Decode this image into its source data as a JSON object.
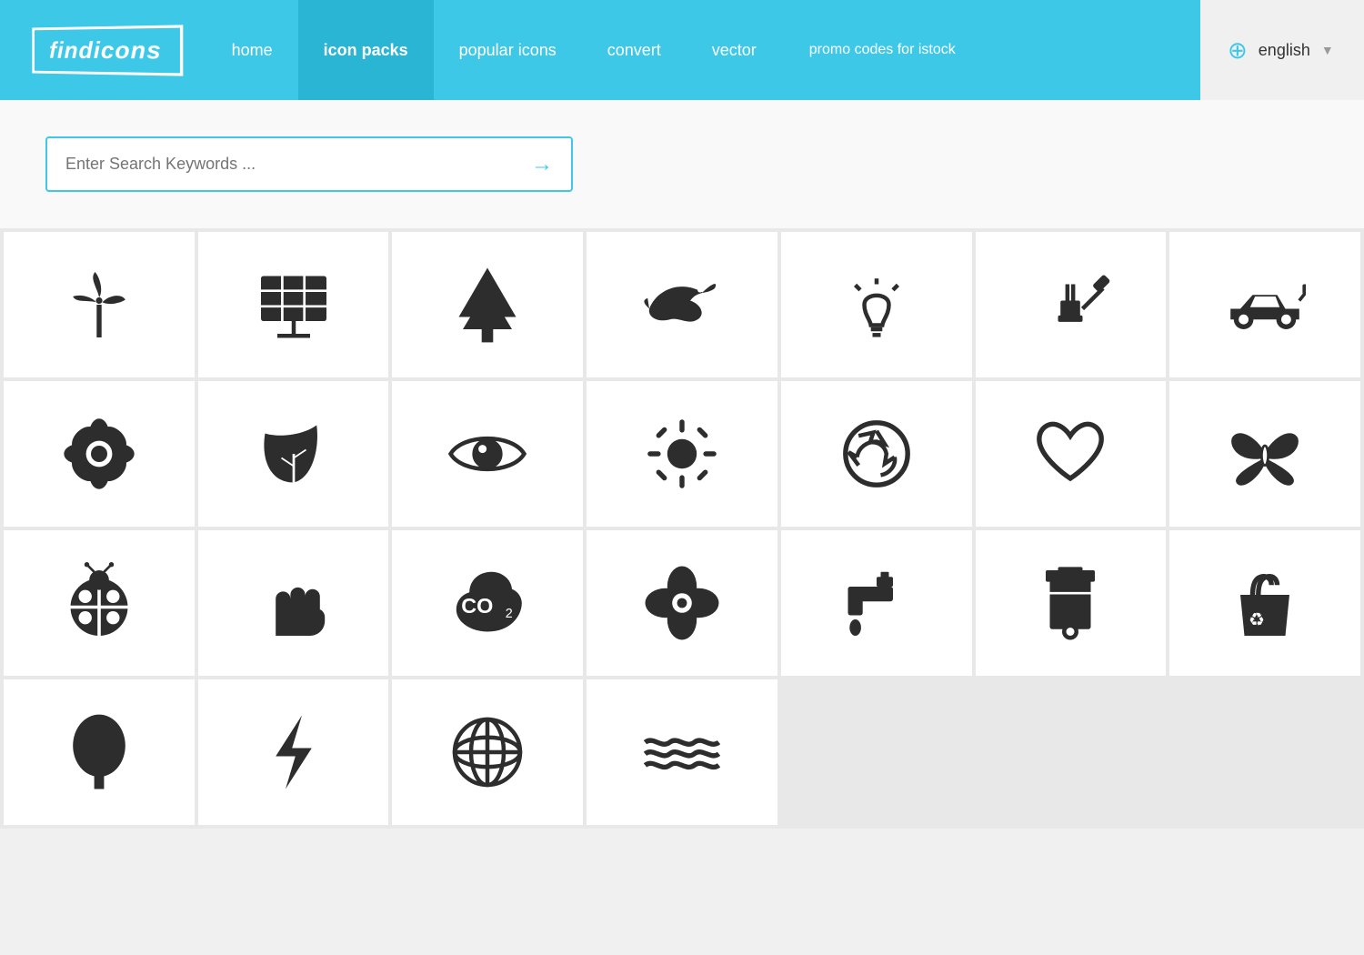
{
  "nav": {
    "logo": "findicons",
    "links": [
      {
        "label": "home",
        "active": false
      },
      {
        "label": "icon packs",
        "active": true
      },
      {
        "label": "popular icons",
        "active": false
      },
      {
        "label": "convert",
        "active": false
      },
      {
        "label": "vector",
        "active": false
      }
    ],
    "promo": "promo codes for istock",
    "lang": "english"
  },
  "search": {
    "placeholder": "Enter Search Keywords ..."
  },
  "icons": [
    {
      "name": "wind-turbine"
    },
    {
      "name": "solar-panel"
    },
    {
      "name": "pine-tree"
    },
    {
      "name": "bird"
    },
    {
      "name": "lightbulb"
    },
    {
      "name": "plug"
    },
    {
      "name": "electric-car"
    },
    {
      "name": "flower"
    },
    {
      "name": "leaf"
    },
    {
      "name": "eye"
    },
    {
      "name": "sun"
    },
    {
      "name": "recycle"
    },
    {
      "name": "heart"
    },
    {
      "name": "butterfly"
    },
    {
      "name": "ladybug"
    },
    {
      "name": "hand"
    },
    {
      "name": "co2"
    },
    {
      "name": "sprout"
    },
    {
      "name": "faucet"
    },
    {
      "name": "trash-bin"
    },
    {
      "name": "recycle-bag"
    },
    {
      "name": "tree"
    },
    {
      "name": "lightning"
    },
    {
      "name": "globe"
    },
    {
      "name": "waves"
    },
    {
      "name": "empty"
    },
    {
      "name": "empty"
    },
    {
      "name": "empty"
    }
  ]
}
